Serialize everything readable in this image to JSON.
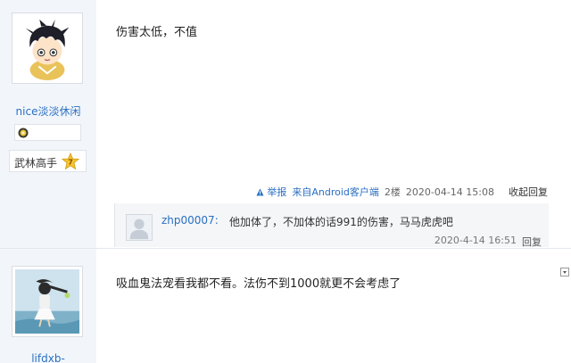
{
  "post1": {
    "author": {
      "name": "nice淡淡休闲",
      "rank_label": "武林高手",
      "rank_level": "7",
      "avatar_icon": "anime-boy-avatar",
      "medal_icon": "gold-medal-icon"
    },
    "content": "伤害太低，不值",
    "meta": {
      "report_label": "举报",
      "client_text": "来自Android客户端",
      "floor": "2楼",
      "time": "2020-04-14 15:08",
      "collapse_label": "收起回复"
    },
    "reply": {
      "user": "zhp00007:",
      "text": "他加体了，不加体的话991的伤害，马马虎虎吧",
      "time": "2020-4-14 16:51",
      "reply_label": "回复",
      "avatar_icon": "default-user-avatar"
    }
  },
  "post2": {
    "author": {
      "name": "lifdxb-",
      "avatar_icon": "girl-sitting-avatar"
    },
    "content": "吸血鬼法宠看我都不看。法伤不到1000就更不会考虑了"
  },
  "colors": {
    "link": "#2a6fc2",
    "sidebar_bg": "#f2f6fb",
    "reply_bg": "#f4f6f8"
  }
}
